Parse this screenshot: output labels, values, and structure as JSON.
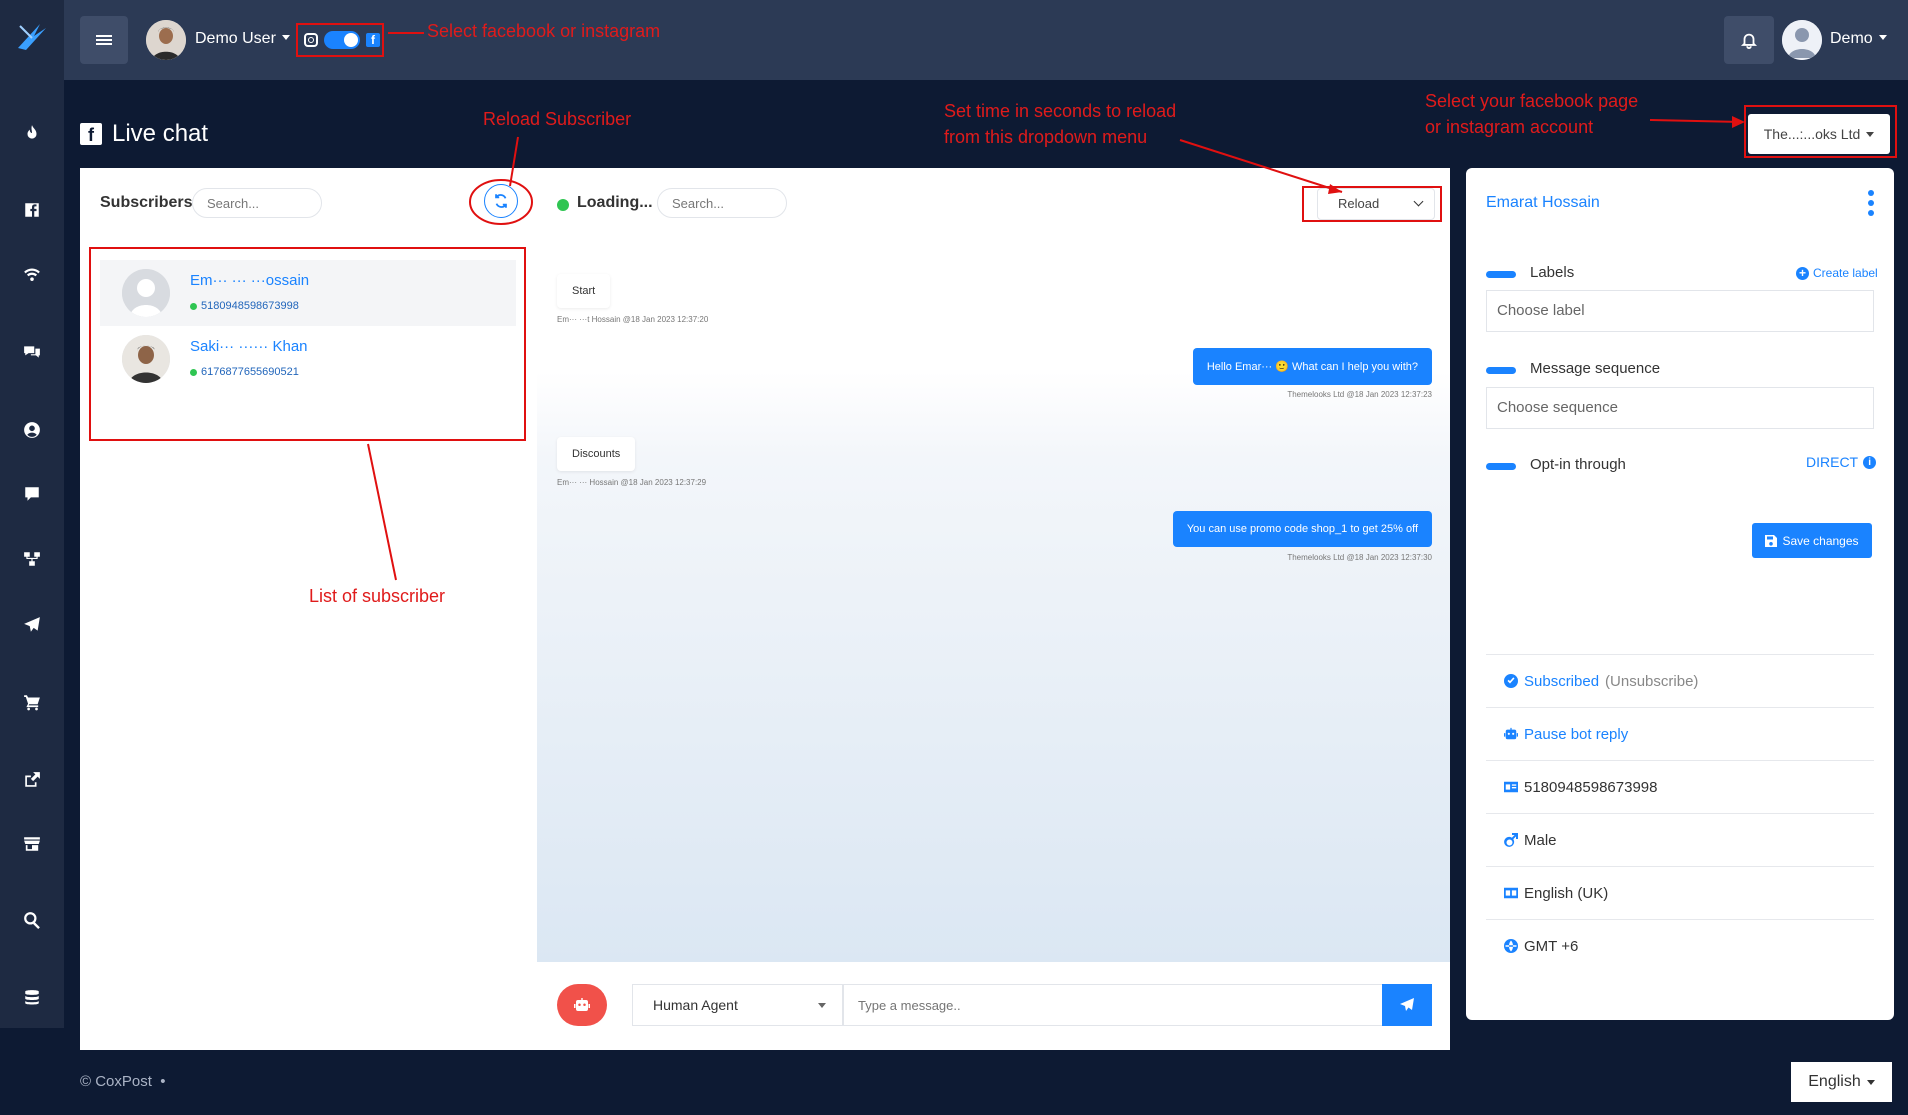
{
  "topbar": {
    "user_name": "Demo User",
    "account_name": "Demo"
  },
  "page": {
    "title": "Live chat",
    "page_selector": "The...:...oks Ltd"
  },
  "subscribers": {
    "label": "Subscribers",
    "search_placeholder": "Search...",
    "items": [
      {
        "name": "Em··· ··· ···ossain",
        "id": "5180948598673998"
      },
      {
        "name": "Saki··· ······ Khan",
        "id": "6176877655690521"
      }
    ]
  },
  "chat": {
    "status": "Loading...",
    "search_placeholder": "Search...",
    "reload_label": "Reload",
    "messages": [
      {
        "dir": "in",
        "text": "Start",
        "meta": "Em··· ···t Hossain @18 Jan 2023 12:37:20"
      },
      {
        "dir": "out",
        "text": "Hello Emar··· 🙂 What can I help you with?",
        "meta": "Themelooks Ltd @18 Jan 2023 12:37:23"
      },
      {
        "dir": "in",
        "text": "Discounts",
        "meta": "Em··· ··· Hossain @18 Jan 2023 12:37:29"
      },
      {
        "dir": "out",
        "text": "You can use promo code shop_1 to get 25% off",
        "meta": "Themelooks Ltd @18 Jan 2023 12:37:30"
      }
    ],
    "agent_label": "Human Agent",
    "message_placeholder": "Type a message.."
  },
  "info": {
    "name": "Emarat Hossain",
    "labels_title": "Labels",
    "create_label": "Create label",
    "label_placeholder": "Choose label",
    "sequence_title": "Message sequence",
    "sequence_placeholder": "Choose sequence",
    "optin_title": "Opt-in through",
    "optin_value": "DIRECT",
    "save_label": "Save changes",
    "subscribed": "Subscribed",
    "unsubscribe": "(Unsubscribe)",
    "pause_bot": "Pause bot reply",
    "subscriber_id": "5180948598673998",
    "gender": "Male",
    "language": "English (UK)",
    "timezone": "GMT +6"
  },
  "footer": {
    "copyright": "© CoxPost",
    "dot": "•",
    "language": "English"
  },
  "annotations": {
    "platform": "Select facebook or instagram",
    "reload_subscriber": "Reload Subscriber",
    "reload_time_1": "Set time in seconds to reload",
    "reload_time_2": "from this dropdown menu",
    "page_select_1": "Select your facebook page",
    "page_select_2": "or instagram account",
    "list": "List of subscriber"
  },
  "colors": {
    "accent": "#1a83ff",
    "annotation": "#e01b1b",
    "online": "#2fc552",
    "bot_button": "#f1514a",
    "background": "#0d1a33"
  }
}
